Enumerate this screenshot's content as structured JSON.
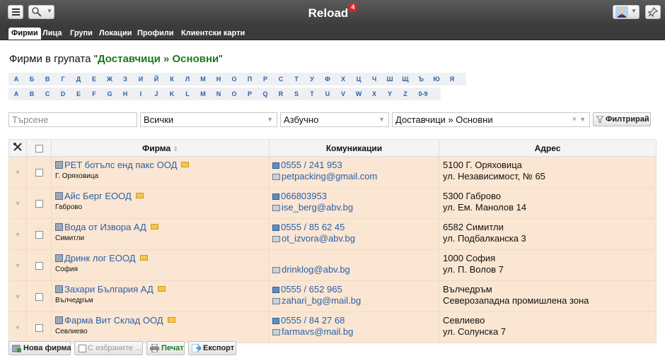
{
  "app": {
    "title": "Reload",
    "badge": "4"
  },
  "nav": {
    "tabs": [
      "Фирми",
      "Лица",
      "Групи",
      "Локации",
      "Профили",
      "Клиентски карти"
    ]
  },
  "heading": {
    "prefix": "Фирми в групата \"",
    "group": "Доставчици » Основни",
    "suffix": "\""
  },
  "alphabet": {
    "cyrillic": [
      "А",
      "Б",
      "В",
      "Г",
      "Д",
      "Е",
      "Ж",
      "З",
      "И",
      "Й",
      "К",
      "Л",
      "М",
      "Н",
      "О",
      "П",
      "Р",
      "С",
      "Т",
      "У",
      "Ф",
      "Х",
      "Ц",
      "Ч",
      "Ш",
      "Щ",
      "Ъ",
      "Ю",
      "Я"
    ],
    "latin": [
      "A",
      "B",
      "C",
      "D",
      "E",
      "F",
      "G",
      "H",
      "I",
      "J",
      "K",
      "L",
      "M",
      "N",
      "O",
      "P",
      "Q",
      "R",
      "S",
      "T",
      "U",
      "V",
      "W",
      "X",
      "Y",
      "Z",
      "0-9"
    ]
  },
  "filters": {
    "search_placeholder": "Търсене",
    "type_value": "Всички",
    "sort_value": "Азбучно",
    "group_value": "Доставчици » Основни",
    "filter_button": "Филтрирай"
  },
  "table": {
    "headers": {
      "firm": "Фирма",
      "communications": "Комуникации",
      "address": "Адрес"
    },
    "rows": [
      {
        "name": "PET ботълс енд пакс ООД",
        "city": "Г. Оряховица",
        "phone": "0555 / 241 953",
        "email": "petpacking@gmail.com",
        "addr1": "5100 Г. Оряховица",
        "addr2": "ул. Независимост, № 65"
      },
      {
        "name": "Айс Берг ЕООД",
        "city": "Габрово",
        "phone": "066803953",
        "email": "ise_berg@abv.bg",
        "addr1": "5300 Габрово",
        "addr2": "ул. Ем. Манолов 14"
      },
      {
        "name": "Вода от Извора АД",
        "city": "Симитли",
        "phone": "0555 / 85 62 45",
        "email": "ot_izvora@abv.bg",
        "addr1": "6582 Симитли",
        "addr2": "ул. Подбалканска 3"
      },
      {
        "name": "Дринк лог ЕООД",
        "city": "София",
        "phone": "",
        "email": "drinklog@abv.bg",
        "addr1": "1000 София",
        "addr2": "ул. П. Волов 7"
      },
      {
        "name": "Захари България АД",
        "city": "Вълчедръм",
        "phone": "0555 / 652 965",
        "email": "zahari_bg@mail.bg",
        "addr1": "Вълчедръм",
        "addr2": "Северозападна промишлена зона"
      },
      {
        "name": "Фарма Вит Склад ООД",
        "city": "Севлиево",
        "phone": "0555 / 84 27 68",
        "email": "farmavs@mail.bg",
        "addr1": "Севлиево",
        "addr2": "ул. Солунска 7"
      }
    ]
  },
  "actions": {
    "new_firm": "Нова фирма",
    "with_selected": "С избраните ...",
    "print": "Печат",
    "export": "Експорт"
  }
}
